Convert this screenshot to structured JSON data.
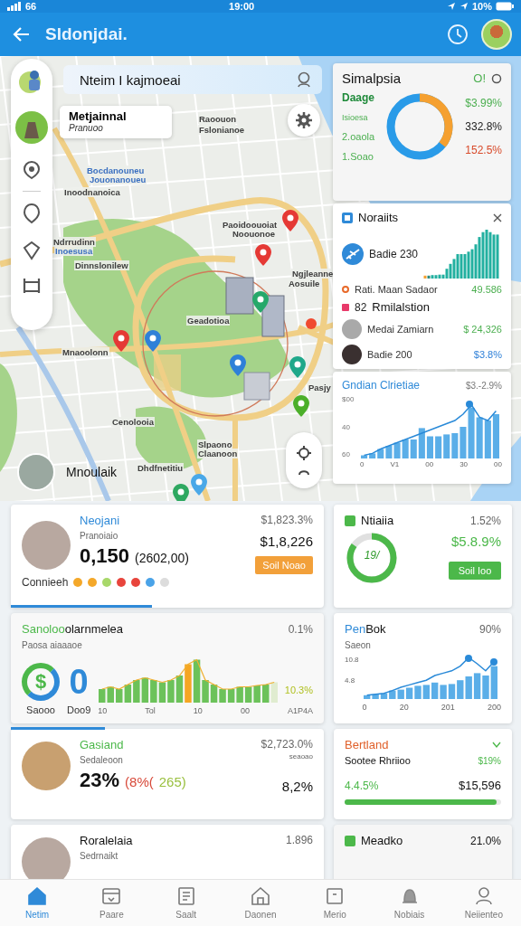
{
  "status_bar": {
    "signal_text": "66",
    "time": "19:00",
    "battery": "10%"
  },
  "app_bar": {
    "title": "Sldonjdai."
  },
  "map": {
    "search": {
      "value": "Nteim I kajmoeai"
    },
    "place_card": {
      "title": "Metjainnal",
      "subtitle": "Pranuoo"
    },
    "labels": [
      {
        "text": "Raoouon",
        "kind": "place"
      },
      {
        "text": "Fslonianoe",
        "kind": "place"
      },
      {
        "text": "Bocdanouneu",
        "kind": "water"
      },
      {
        "text": "Jouonanoueu",
        "kind": "water"
      },
      {
        "text": "Inoodnanoica",
        "kind": "place"
      },
      {
        "text": "Paoidoouoiat",
        "kind": "place"
      },
      {
        "text": "Noouonoe",
        "kind": "place"
      },
      {
        "text": "Ndrrudinn",
        "kind": "place"
      },
      {
        "text": "Inoesusa",
        "kind": "water"
      },
      {
        "text": "Dinnslonilew",
        "kind": "place"
      },
      {
        "text": "Ngjleanne",
        "kind": "place"
      },
      {
        "text": "Aosuile",
        "kind": "place"
      },
      {
        "text": "Geadotioa",
        "kind": "place"
      },
      {
        "text": "Mnaoolonn",
        "kind": "place"
      },
      {
        "text": "Pasjy",
        "kind": "place"
      },
      {
        "text": "Cenolooia",
        "kind": "place"
      },
      {
        "text": "Slpaono",
        "kind": "place"
      },
      {
        "text": "Claanoon",
        "kind": "place"
      },
      {
        "text": "Dhdfnetitiu",
        "kind": "place"
      }
    ],
    "pins": [
      {
        "color": "#e53935"
      },
      {
        "color": "#e53935"
      },
      {
        "color": "#26a86a"
      },
      {
        "color": "#e53935"
      },
      {
        "color": "#2f80d8"
      },
      {
        "color": "#2f80d8"
      },
      {
        "color": "#1fa88a"
      },
      {
        "color": "#4caf2a"
      },
      {
        "color": "#4aa8e8"
      },
      {
        "color": "#2ea860"
      }
    ],
    "person": {
      "name": "Mnoulaik"
    }
  },
  "summary": {
    "title": "Simalpsia",
    "action": "O!",
    "labels": [
      {
        "text": "Daage",
        "kind": "heading"
      },
      {
        "text": "Isioesa",
        "kind": "small"
      },
      {
        "text": "2.oaola",
        "kind": "item"
      },
      {
        "text": "1.Soao",
        "kind": "item"
      }
    ],
    "values": [
      {
        "text": "$3.99%",
        "color": "#4caf50"
      },
      {
        "text": "332.8%",
        "color": "#222222"
      },
      {
        "text": "152.5%",
        "color": "#d84a2a"
      }
    ]
  },
  "activity": {
    "title": "Noraiits",
    "flight": "Badie 230",
    "rows": [
      {
        "label": "Rati. Maan Sadaor",
        "value": "49.586"
      }
    ],
    "section_badge": "82",
    "section_title": "Rmilalstion",
    "people": [
      {
        "label": "Medai Zamiarn",
        "value": "$ 24,326",
        "color": "#4caf50"
      },
      {
        "label": "Badie 200",
        "value": "$3.8%",
        "color": "#2f80d8"
      }
    ]
  },
  "trend": {
    "title": "Gndian Clrietiae",
    "value": "$3.-2.9%",
    "yticks": [
      "$00",
      "40",
      "60"
    ],
    "xticks": [
      "0",
      "V1",
      "00",
      "30",
      "00"
    ]
  },
  "cards": {
    "profile": {
      "title": "Neojani",
      "subtitle": "Pranoiaio",
      "amount": "0,150",
      "amount_note": "(2602,00)",
      "top_value": "$1,823.3%",
      "value": "$1,8,226",
      "button": "Soil Noao",
      "footer": "Connieeh",
      "level": 0.45,
      "dots": [
        {
          "color": "#f4a82a"
        },
        {
          "color": "#f4a82a"
        },
        {
          "color": "#a8d86a"
        },
        {
          "color": "#e8453c"
        },
        {
          "color": "#e8453c"
        },
        {
          "color": "#4aa3e8"
        },
        {
          "color": "#dcdcdc"
        }
      ]
    },
    "gauge": {
      "title": "Ntiaiia",
      "top_value": "1.52%",
      "gauge_text": "19/",
      "value": "$5.8.9%",
      "button": "Soil Ioo",
      "level": 0.85
    },
    "sales": {
      "title_lead": "Sanoloo",
      "title_rest": "olarnmelea",
      "value": "0.1%",
      "subtitle": "Paosa aiaaaoe",
      "symbol": "$",
      "big": "0",
      "captions": [
        "Saooo",
        "Doo9"
      ],
      "chart_note": "10.3%",
      "xticks": [
        "10",
        "Tol",
        "10",
        "00",
        "A1P4A"
      ]
    },
    "growth": {
      "title_lead": "Pen",
      "title_rest": "Bok",
      "value": "90%",
      "subtitle": "Saeon",
      "yticks": [
        "10.8",
        "4.8"
      ],
      "xticks": [
        "0",
        "20",
        "201",
        "200"
      ]
    },
    "landmark": {
      "title": "Gasiand",
      "subtitle": "Sedaleoon",
      "big": "23%",
      "note_a": "(8%(",
      "note_b": "265)",
      "top_value": "$2,723.0%",
      "top_sub": "seaoao",
      "value": "8,2%",
      "level": 0.3
    },
    "region": {
      "title": "Bertland",
      "subtitle": "Sootee Rhriioo",
      "side": "$19%",
      "left_value": "4.4.5%",
      "value": "$15,596",
      "level": 0.97
    },
    "person": {
      "title": "Roralelaia",
      "subtitle": "Sedrnaikt",
      "top_value": "1.896"
    },
    "media": {
      "title": "Meadko",
      "value": "21.0%"
    }
  },
  "nav": [
    {
      "label": "Netim",
      "selected": true
    },
    {
      "label": "Paare",
      "selected": false
    },
    {
      "label": "Saalt",
      "selected": false
    },
    {
      "label": "Daonen",
      "selected": false
    },
    {
      "label": "Merio",
      "selected": false
    },
    {
      "label": "Nobiais",
      "selected": false
    },
    {
      "label": "Neiienteo",
      "selected": false
    }
  ]
}
